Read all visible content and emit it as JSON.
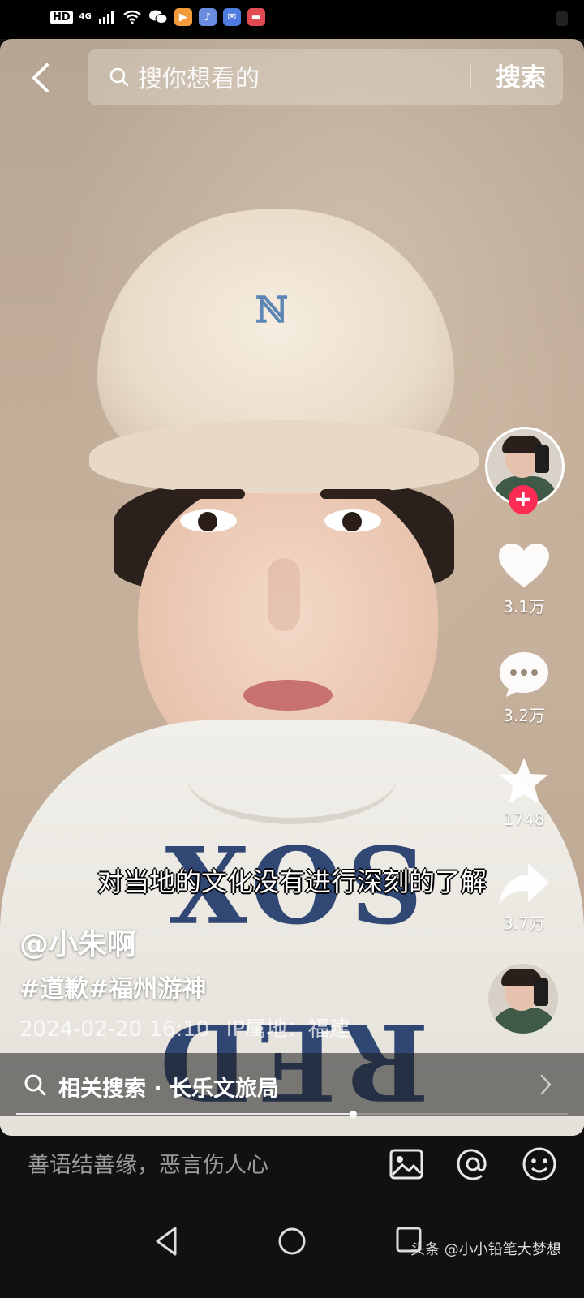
{
  "status_bar": {
    "hd_label": "HD",
    "network_label": "4G"
  },
  "search": {
    "placeholder": "搜你想看的",
    "button_label": "搜索"
  },
  "video": {
    "subtitle": "对当地的文化没有进行深刻的了解",
    "author": "@小朱啊",
    "hashtags": [
      "#道歉",
      "#福州游神"
    ],
    "post_time": "2024-02-20 16:10",
    "ip_location": "IP属地：福建",
    "related_search": "相关搜索 · 长乐文旅局",
    "progress": 0.61
  },
  "actions": {
    "likes": "3.1万",
    "comments": "3.2万",
    "favorites": "1748",
    "shares": "3.7万"
  },
  "comment": {
    "placeholder": "善语结善缘，恶言伤人心"
  },
  "watermark": {
    "text": "头条 @小小铅笔大梦想"
  },
  "colors": {
    "follow_button": "#fe2c55",
    "background": "#111111"
  }
}
